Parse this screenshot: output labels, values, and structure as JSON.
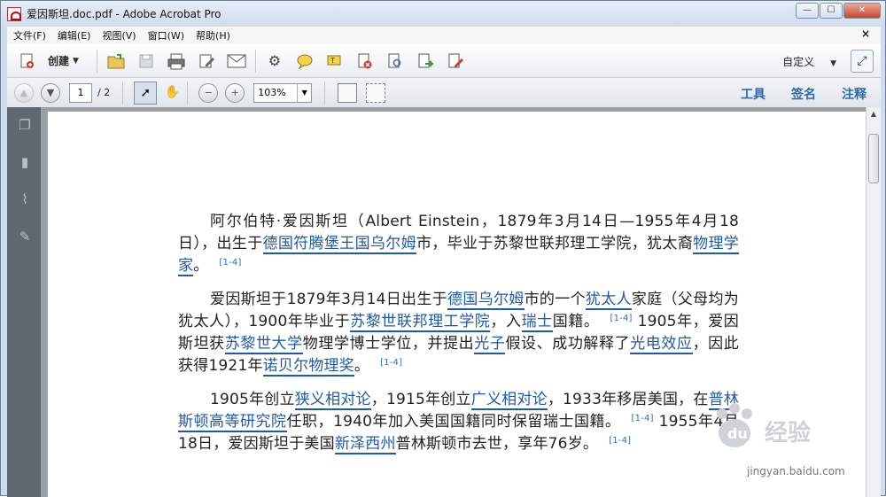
{
  "window": {
    "title": "爱因斯坦.doc.pdf - Adobe Acrobat Pro"
  },
  "menu": {
    "items": [
      "文件(F)",
      "编辑(E)",
      "视图(V)",
      "窗口(W)",
      "帮助(H)"
    ],
    "close": "×"
  },
  "toolbar": {
    "create_label": "创建",
    "custom_label": "自定义"
  },
  "nav": {
    "page_current": "1",
    "page_total": "/ 2",
    "zoom": "103%"
  },
  "panes": {
    "tools": "工具",
    "sign": "签名",
    "comment": "注释"
  },
  "document": {
    "paragraphs": [
      [
        {
          "t": "阿尔伯特·爱因斯坦（Albert Einstein，1879年3月14日—1955年4月18日），出生于"
        },
        {
          "t": "德国符腾堡王国乌尔姆",
          "link": true
        },
        {
          "t": "市，毕业于苏黎世联邦理工学院，犹太裔"
        },
        {
          "t": "物理学家",
          "link": true
        },
        {
          "t": "。"
        },
        {
          "t": "[1-4]",
          "sup": true
        }
      ],
      [
        {
          "t": "爱因斯坦于1879年3月14日出生于"
        },
        {
          "t": "德国乌尔姆",
          "link": true
        },
        {
          "t": "市的一个"
        },
        {
          "t": "犹太人",
          "link": true
        },
        {
          "t": "家庭（父母均为犹太人），1900年毕业于"
        },
        {
          "t": "苏黎世联邦理工学院",
          "link": true
        },
        {
          "t": "，入"
        },
        {
          "t": "瑞士",
          "link": true
        },
        {
          "t": "国籍。"
        },
        {
          "t": "[1-4]",
          "sup": true
        },
        {
          "t": " 1905年，爱因斯坦获"
        },
        {
          "t": "苏黎世大学",
          "link": true
        },
        {
          "t": "物理学博士学位，并提出"
        },
        {
          "t": "光子",
          "link": true
        },
        {
          "t": "假设、成功解释了"
        },
        {
          "t": "光电效应",
          "link": true
        },
        {
          "t": "，因此获得1921年"
        },
        {
          "t": "诺贝尔物理奖",
          "link": true
        },
        {
          "t": "。"
        },
        {
          "t": "[1-4]",
          "sup": true
        }
      ],
      [
        {
          "t": "1905年创立"
        },
        {
          "t": "狭义相对论",
          "link": true
        },
        {
          "t": "，1915年创立"
        },
        {
          "t": "广义相对论",
          "link": true
        },
        {
          "t": "，1933年移居美国，在"
        },
        {
          "t": "普林斯顿高等研究院",
          "link": true
        },
        {
          "t": "任职，1940年加入美国国籍同时保留瑞士国籍。"
        },
        {
          "t": "[1-4]",
          "sup": true
        },
        {
          "t": " 1955年4月18日，爱因斯坦于美国"
        },
        {
          "t": "新泽西州",
          "link": true
        },
        {
          "t": "普林斯顿市去世，享年76岁。"
        },
        {
          "t": "[1-4]",
          "sup": true
        }
      ]
    ]
  },
  "watermark": {
    "text": "Bai度 经验",
    "url": "jingyan.baidu.com"
  }
}
